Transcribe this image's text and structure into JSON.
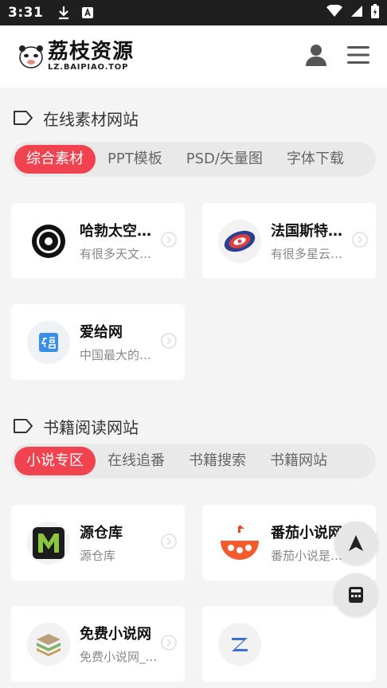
{
  "status_bar": {
    "time": "3:31"
  },
  "header": {
    "title": "荔枝资源",
    "subtitle": "LZ.BAIPIAO.TOP"
  },
  "section1": {
    "title": "在线素材网站",
    "tabs": [
      {
        "label": "综合素材",
        "active": true
      },
      {
        "label": "PPT模板",
        "active": false
      },
      {
        "label": "PSD/矢量图",
        "active": false
      },
      {
        "label": "字体下载",
        "active": false
      }
    ],
    "cards": [
      {
        "name": "哈勃太空…",
        "desc": "有很多天文…",
        "icon": "hubble-icon"
      },
      {
        "name": "法国斯特…",
        "desc": "有很多星云…",
        "icon": "galaxy-icon"
      },
      {
        "name": "爱给网",
        "desc": "中国最大的…",
        "icon": "aigei-icon"
      }
    ]
  },
  "section2": {
    "title": "书籍阅读网站",
    "tabs": [
      {
        "label": "小说专区",
        "active": true
      },
      {
        "label": "在线追番",
        "active": false
      },
      {
        "label": "书籍搜索",
        "active": false
      },
      {
        "label": "书籍网站",
        "active": false
      }
    ],
    "cards": [
      {
        "name": "源仓库",
        "desc": "源仓库",
        "icon": "m-logo-icon"
      },
      {
        "name": "番茄小说网",
        "desc": "番茄小说是…",
        "icon": "tomato-icon"
      },
      {
        "name": "免费小说网",
        "desc": "免费小说网_…",
        "icon": "book-stack-icon"
      },
      {
        "name": "",
        "desc": "",
        "icon": "z-logo-icon"
      }
    ]
  },
  "colors": {
    "accent": "#f0434f",
    "background": "#f4f4f4"
  }
}
